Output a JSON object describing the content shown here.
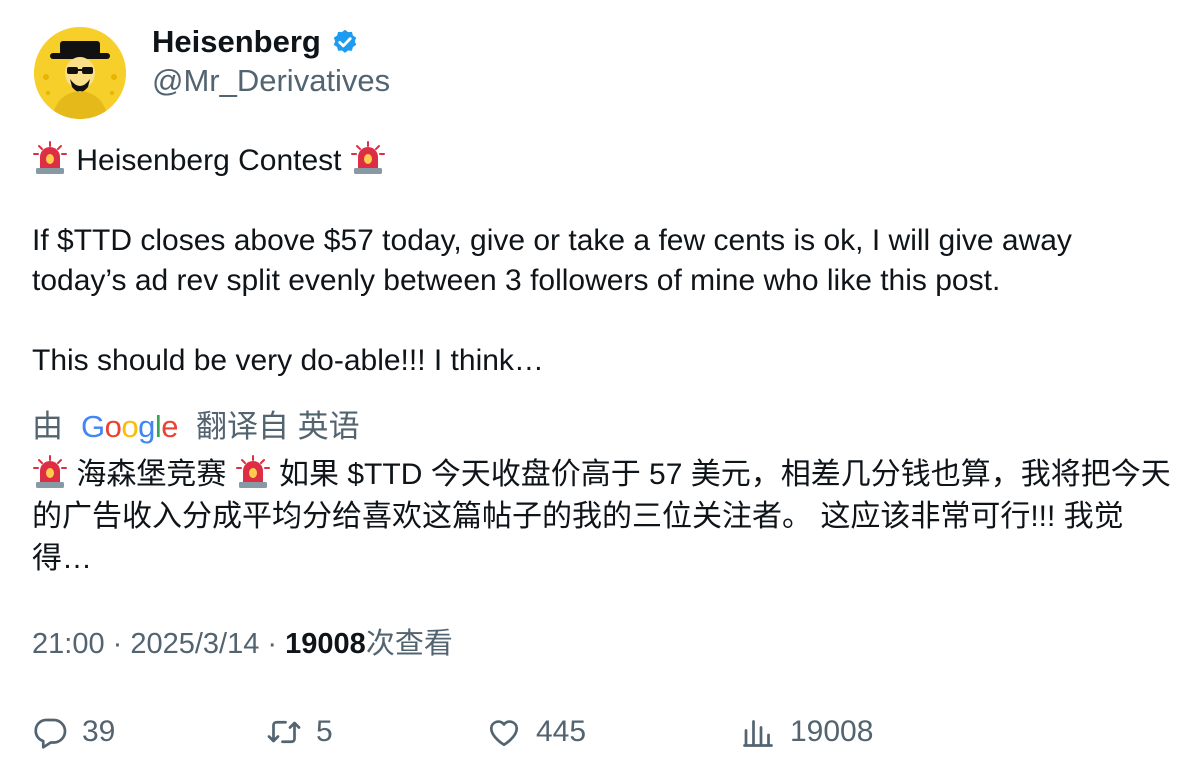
{
  "author": {
    "name": "Heisenberg",
    "handle": "@Mr_Derivatives",
    "verified": true,
    "verified_color": "#1d9bf0"
  },
  "post": {
    "title_line": "Heisenberg Contest",
    "paragraph1": "If $TTD closes above $57 today, give or take a few cents is ok, I will give away today’s ad rev split evenly between 3 followers of mine who like this post.",
    "paragraph2": "This should be very do-able!!! I think…",
    "siren_icon": "police-car-light-icon"
  },
  "translation": {
    "prefix": "由",
    "provider": "Google",
    "suffix": "翻译自 英语",
    "title_line": "海森堡竞赛",
    "text": "如果 $TTD 今天收盘价高于 57 美元，相差几分钱也算，我将把今天的广告收入分成平均分给喜欢这篇帖子的我的三位关注者。 这应该非常可行!!! 我觉得…"
  },
  "meta": {
    "time": "21:00",
    "separator": " · ",
    "date": "2025/3/14",
    "views_count": "19008",
    "views_label": "次查看"
  },
  "actions": {
    "replies": "39",
    "reposts": "5",
    "likes": "445",
    "views": "19008"
  },
  "colors": {
    "text_primary": "#0f1419",
    "text_secondary": "#536471",
    "avatar_bg": "#f6cf2a"
  }
}
